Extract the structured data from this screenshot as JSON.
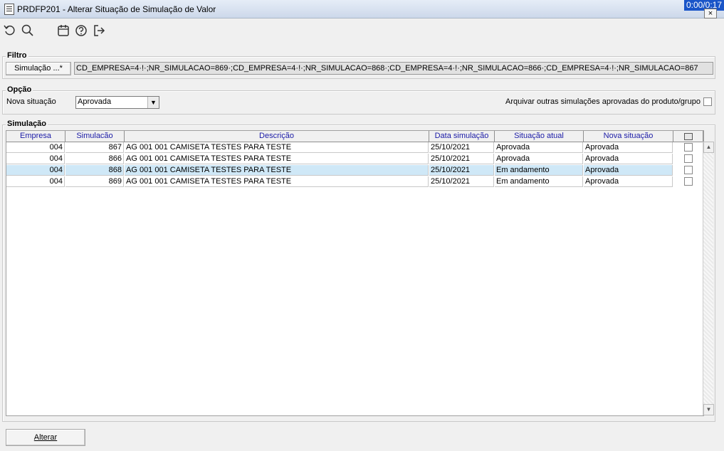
{
  "window": {
    "title": "PRDFP201 - Alterar Situação de Simulação de Valor",
    "timer": "0:00/0:17",
    "close_label": "×"
  },
  "toolbar": {
    "icons": [
      "refresh-icon",
      "search-icon",
      "calendar-icon",
      "help-icon",
      "exit-icon"
    ]
  },
  "filtro": {
    "legend": "Filtro",
    "button_label": "Simulação ...*",
    "value": "CD_EMPRESA=4·!·;NR_SIMULACAO=869·;CD_EMPRESA=4·!·;NR_SIMULACAO=868·;CD_EMPRESA=4·!·;NR_SIMULACAO=866·;CD_EMPRESA=4·!·;NR_SIMULACAO=867"
  },
  "opcao": {
    "legend": "Opção",
    "nova_situacao_label": "Nova situação",
    "nova_situacao_value": "Aprovada",
    "arquivar_label": "Arquivar outras simulações aprovadas do produto/grupo",
    "arquivar_checked": false
  },
  "simulacao": {
    "legend": "Simulação",
    "columns": [
      "Empresa",
      "Simulacão",
      "Descrição",
      "Data simulação",
      "Situação atual",
      "Nova situação"
    ],
    "rows": [
      {
        "empresa": "004",
        "simulacao": "867",
        "descricao": "AG 001 001 CAMISETA TESTES PARA TESTE",
        "data": "25/10/2021",
        "situacao_atual": "Aprovada",
        "nova_situacao": "Aprovada",
        "selected": false
      },
      {
        "empresa": "004",
        "simulacao": "866",
        "descricao": "AG 001 001 CAMISETA TESTES PARA TESTE",
        "data": "25/10/2021",
        "situacao_atual": "Aprovada",
        "nova_situacao": "Aprovada",
        "selected": false
      },
      {
        "empresa": "004",
        "simulacao": "868",
        "descricao": "AG 001 001 CAMISETA TESTES PARA TESTE",
        "data": "25/10/2021",
        "situacao_atual": "Em andamento",
        "nova_situacao": "Aprovada",
        "selected": true
      },
      {
        "empresa": "004",
        "simulacao": "869",
        "descricao": "AG 001 001 CAMISETA TESTES PARA TESTE",
        "data": "25/10/2021",
        "situacao_atual": "Em andamento",
        "nova_situacao": "Aprovada",
        "selected": false
      }
    ]
  },
  "footer": {
    "alterar_label": "Alterar"
  }
}
